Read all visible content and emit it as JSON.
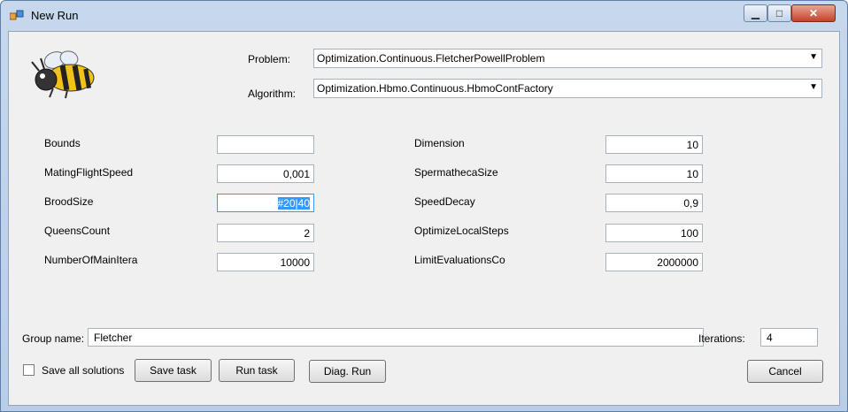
{
  "window": {
    "title": "New Run"
  },
  "problem": {
    "label": "Problem:",
    "value": "Optimization.Continuous.FletcherPowellProblem"
  },
  "algorithm": {
    "label": "Algorithm:",
    "value": "Optimization.Hbmo.Continuous.HbmoContFactory"
  },
  "params_left": [
    {
      "label": "Bounds",
      "value": ""
    },
    {
      "label": "MatingFlightSpeed",
      "value": "0,001"
    },
    {
      "label": "BroodSize",
      "value": "#20|40"
    },
    {
      "label": "QueensCount",
      "value": "2"
    },
    {
      "label": "NumberOfMainItera",
      "value": "10000"
    }
  ],
  "params_right": [
    {
      "label": "Dimension",
      "value": "10"
    },
    {
      "label": "SpermathecaSize",
      "value": "10"
    },
    {
      "label": "SpeedDecay",
      "value": "0,9"
    },
    {
      "label": "OptimizeLocalSteps",
      "value": "100"
    },
    {
      "label": "LimitEvaluationsCo",
      "value": "2000000"
    }
  ],
  "group": {
    "label": "Group name:",
    "value": "Fletcher"
  },
  "iterations": {
    "label": "Iterations:",
    "value": "4"
  },
  "save_all": {
    "label": "Save all solutions",
    "checked": false
  },
  "buttons": {
    "save_task": "Save task",
    "run_task": "Run task",
    "diag_run": "Diag. Run",
    "cancel": "Cancel"
  },
  "icons": {
    "app": "app-window-icon",
    "bee": "bee-logo-icon",
    "dropdown": "chevron-down-icon"
  }
}
